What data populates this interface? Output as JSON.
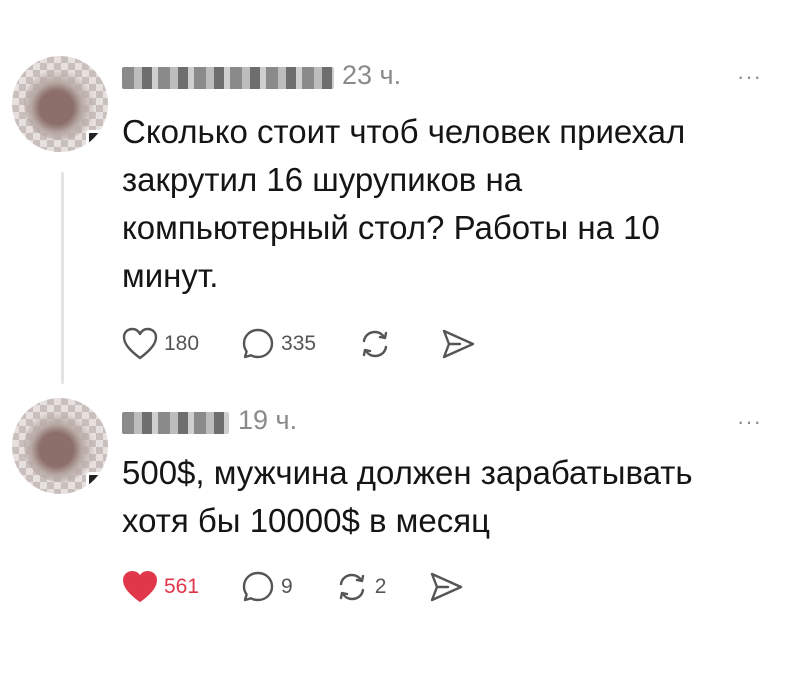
{
  "comments": [
    {
      "time": "23 ч.",
      "more": "···",
      "text": "Сколько стоит чтоб человек приехал закрутил 16 шурупиков на компьютерный стол? Работы на 10 минут.",
      "likes": "180",
      "replies": "335",
      "reposts": "",
      "liked": false
    },
    {
      "time": "19 ч.",
      "more": "···",
      "text": "500$, мужчина должен зарабатывать хотя бы 10000$ в месяц",
      "likes": "561",
      "replies": "9",
      "reposts": "2",
      "liked": true
    }
  ],
  "colors": {
    "like_active": "#e1374b",
    "icon": "#555555",
    "muted": "#8a8a8a"
  },
  "icons": [
    "heart-icon",
    "comment-icon",
    "repost-icon",
    "share-icon",
    "more-icon"
  ]
}
